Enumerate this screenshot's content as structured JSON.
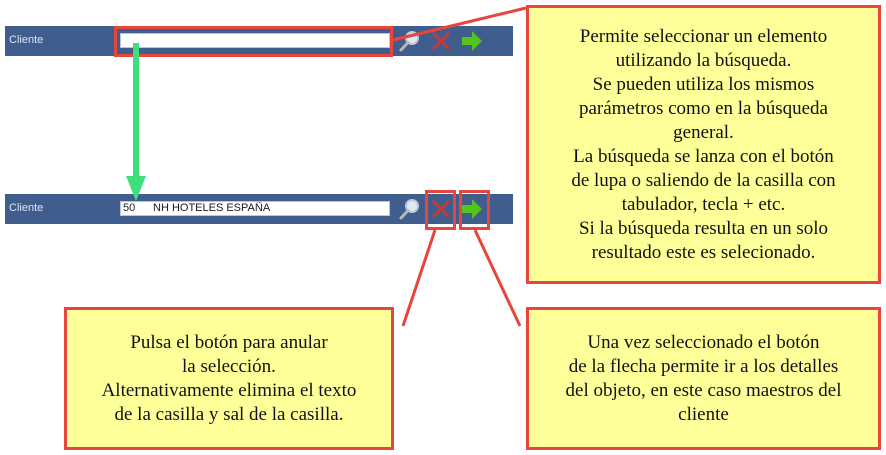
{
  "top_bar": {
    "label": "Cliente",
    "input_value": ""
  },
  "bottom_bar": {
    "label": "Cliente",
    "input_code": "50",
    "input_name": "NH HOTELES ESPAÑA"
  },
  "icons": {
    "search": "magnifier-icon",
    "clear": "red-x-icon",
    "go": "green-arrow-icon"
  },
  "notes": {
    "search": "Permite seleccionar un elemento\nutilizando la búsqueda.\nSe pueden utiliza los mismos\nparámetros como en la búsqueda\ngeneral.\nLa búsqueda se lanza con el botón\nde lupa o saliendo de la casilla con\ntabulador, tecla + etc.\nSi la búsqueda resulta en un solo\nresultado este es selecionado.",
    "clear": "Pulsa el botón para anular\nla selección.\nAlternativamente elimina el texto\nde la casilla y sal de la casilla.",
    "go": "Una vez seleccionado el botón\nde la flecha permite ir a los detalles\ndel objeto, en este caso maestros del\ncliente"
  },
  "colors": {
    "bar": "#3f5e8d",
    "callout_fill": "#ffff99",
    "callout_border": "#e8453c",
    "flow_arrow": "#3de07d"
  }
}
